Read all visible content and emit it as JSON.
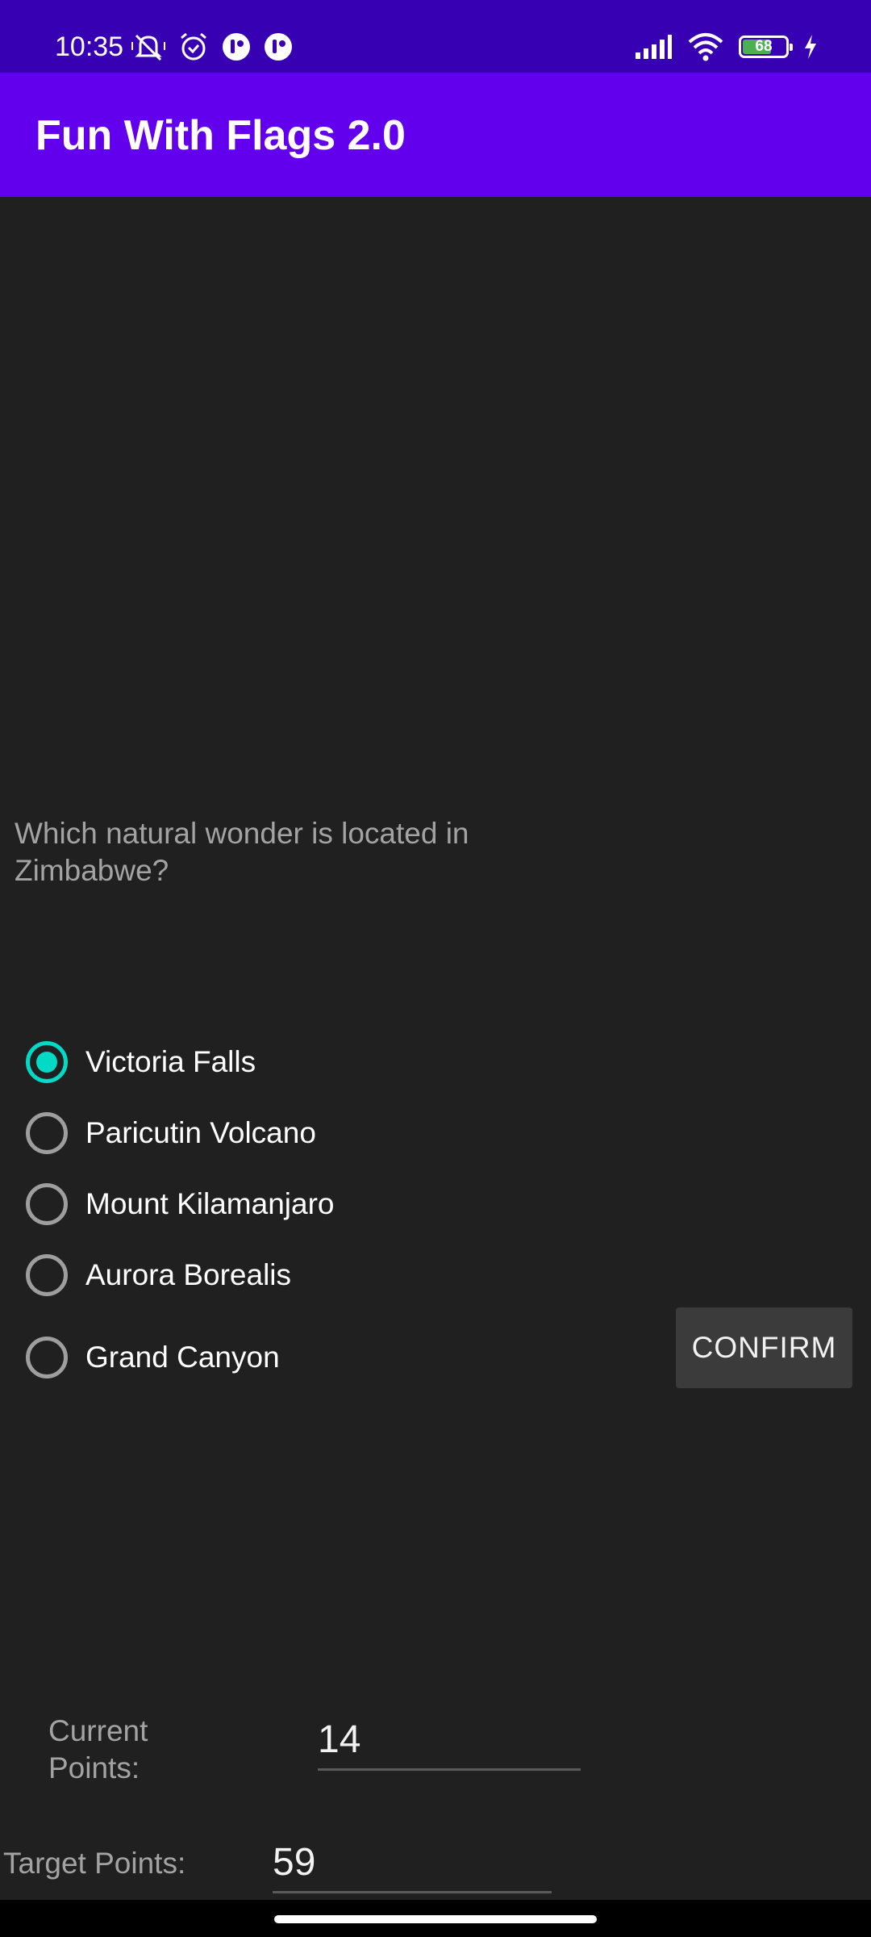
{
  "status_bar": {
    "time": "10:35",
    "battery_level": 68,
    "battery_label": "68",
    "left_icons": [
      "mute-icon",
      "alarm-icon",
      "app-notification-icon",
      "app-notification-icon"
    ],
    "right_icons": [
      "signal-icon",
      "wifi-icon",
      "battery-icon",
      "charging-icon"
    ]
  },
  "app_bar": {
    "title": "Fun With Flags 2.0",
    "color": "#6200ee"
  },
  "quiz": {
    "question": "Which natural wonder is located in Zimbabwe?",
    "options": [
      {
        "label": "Victoria Falls",
        "selected": true
      },
      {
        "label": "Paricutin Volcano",
        "selected": false
      },
      {
        "label": "Mount Kilamanjaro",
        "selected": false
      },
      {
        "label": "Aurora Borealis",
        "selected": false
      },
      {
        "label": "Grand Canyon",
        "selected": false
      }
    ],
    "confirm_label": "CONFIRM",
    "accent_color": "#03dac5"
  },
  "points": {
    "current_label": "Current Points:",
    "current_value": "14",
    "target_label": "Target Points:",
    "target_value": "59"
  }
}
